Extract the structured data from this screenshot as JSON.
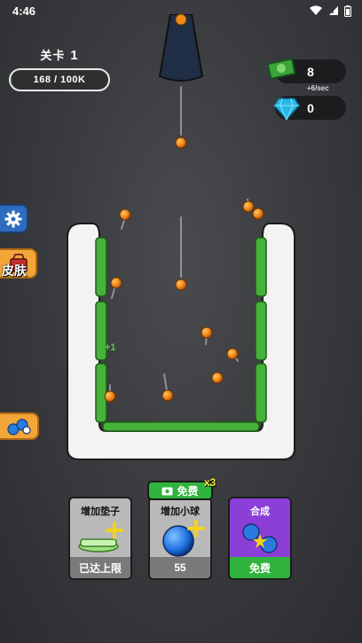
{
  "status_bar": {
    "time": "4:46"
  },
  "level": {
    "label": "关卡",
    "number": "1",
    "progress_text": "168 / 100K",
    "progress_fraction": 0.00168
  },
  "currency": {
    "cash": "8",
    "rate": "+6/sec",
    "gems": "0"
  },
  "side_buttons": {
    "skin_label": "皮肤"
  },
  "board": {
    "float_text": "+1"
  },
  "cards": [
    {
      "title": "增加垫子",
      "bottom": "已达上限"
    },
    {
      "title": "增加小球",
      "bottom": "55",
      "tag": "免费",
      "multiplier": "x3"
    },
    {
      "title": "合成",
      "bottom": "免费"
    }
  ],
  "colors": {
    "board_white": "#f3f3f3",
    "bumper_green": "#46b23a",
    "ball_orange": "#f28a1a",
    "background": "#3a3b3e"
  },
  "icons": [
    "wifi-icon",
    "signal-icon",
    "battery-icon",
    "cash-icon",
    "gem-icon",
    "gear-icon",
    "skin-icon",
    "balls-icon",
    "video-icon"
  ]
}
